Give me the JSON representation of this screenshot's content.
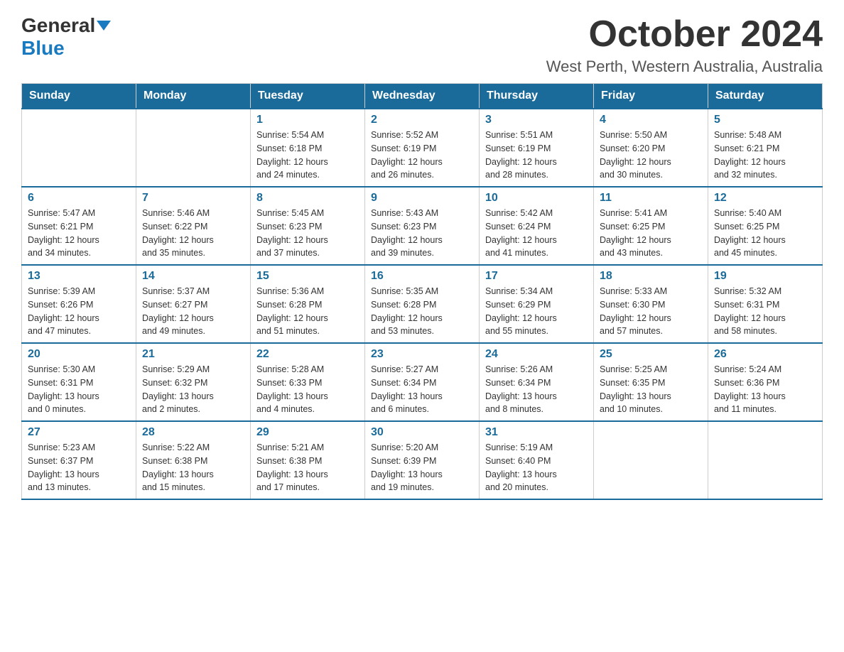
{
  "header": {
    "logo_general": "General",
    "logo_blue": "Blue",
    "month_title": "October 2024",
    "location": "West Perth, Western Australia, Australia"
  },
  "weekdays": [
    "Sunday",
    "Monday",
    "Tuesday",
    "Wednesday",
    "Thursday",
    "Friday",
    "Saturday"
  ],
  "weeks": [
    [
      {
        "day": "",
        "info": ""
      },
      {
        "day": "",
        "info": ""
      },
      {
        "day": "1",
        "info": "Sunrise: 5:54 AM\nSunset: 6:18 PM\nDaylight: 12 hours\nand 24 minutes."
      },
      {
        "day": "2",
        "info": "Sunrise: 5:52 AM\nSunset: 6:19 PM\nDaylight: 12 hours\nand 26 minutes."
      },
      {
        "day": "3",
        "info": "Sunrise: 5:51 AM\nSunset: 6:19 PM\nDaylight: 12 hours\nand 28 minutes."
      },
      {
        "day": "4",
        "info": "Sunrise: 5:50 AM\nSunset: 6:20 PM\nDaylight: 12 hours\nand 30 minutes."
      },
      {
        "day": "5",
        "info": "Sunrise: 5:48 AM\nSunset: 6:21 PM\nDaylight: 12 hours\nand 32 minutes."
      }
    ],
    [
      {
        "day": "6",
        "info": "Sunrise: 5:47 AM\nSunset: 6:21 PM\nDaylight: 12 hours\nand 34 minutes."
      },
      {
        "day": "7",
        "info": "Sunrise: 5:46 AM\nSunset: 6:22 PM\nDaylight: 12 hours\nand 35 minutes."
      },
      {
        "day": "8",
        "info": "Sunrise: 5:45 AM\nSunset: 6:23 PM\nDaylight: 12 hours\nand 37 minutes."
      },
      {
        "day": "9",
        "info": "Sunrise: 5:43 AM\nSunset: 6:23 PM\nDaylight: 12 hours\nand 39 minutes."
      },
      {
        "day": "10",
        "info": "Sunrise: 5:42 AM\nSunset: 6:24 PM\nDaylight: 12 hours\nand 41 minutes."
      },
      {
        "day": "11",
        "info": "Sunrise: 5:41 AM\nSunset: 6:25 PM\nDaylight: 12 hours\nand 43 minutes."
      },
      {
        "day": "12",
        "info": "Sunrise: 5:40 AM\nSunset: 6:25 PM\nDaylight: 12 hours\nand 45 minutes."
      }
    ],
    [
      {
        "day": "13",
        "info": "Sunrise: 5:39 AM\nSunset: 6:26 PM\nDaylight: 12 hours\nand 47 minutes."
      },
      {
        "day": "14",
        "info": "Sunrise: 5:37 AM\nSunset: 6:27 PM\nDaylight: 12 hours\nand 49 minutes."
      },
      {
        "day": "15",
        "info": "Sunrise: 5:36 AM\nSunset: 6:28 PM\nDaylight: 12 hours\nand 51 minutes."
      },
      {
        "day": "16",
        "info": "Sunrise: 5:35 AM\nSunset: 6:28 PM\nDaylight: 12 hours\nand 53 minutes."
      },
      {
        "day": "17",
        "info": "Sunrise: 5:34 AM\nSunset: 6:29 PM\nDaylight: 12 hours\nand 55 minutes."
      },
      {
        "day": "18",
        "info": "Sunrise: 5:33 AM\nSunset: 6:30 PM\nDaylight: 12 hours\nand 57 minutes."
      },
      {
        "day": "19",
        "info": "Sunrise: 5:32 AM\nSunset: 6:31 PM\nDaylight: 12 hours\nand 58 minutes."
      }
    ],
    [
      {
        "day": "20",
        "info": "Sunrise: 5:30 AM\nSunset: 6:31 PM\nDaylight: 13 hours\nand 0 minutes."
      },
      {
        "day": "21",
        "info": "Sunrise: 5:29 AM\nSunset: 6:32 PM\nDaylight: 13 hours\nand 2 minutes."
      },
      {
        "day": "22",
        "info": "Sunrise: 5:28 AM\nSunset: 6:33 PM\nDaylight: 13 hours\nand 4 minutes."
      },
      {
        "day": "23",
        "info": "Sunrise: 5:27 AM\nSunset: 6:34 PM\nDaylight: 13 hours\nand 6 minutes."
      },
      {
        "day": "24",
        "info": "Sunrise: 5:26 AM\nSunset: 6:34 PM\nDaylight: 13 hours\nand 8 minutes."
      },
      {
        "day": "25",
        "info": "Sunrise: 5:25 AM\nSunset: 6:35 PM\nDaylight: 13 hours\nand 10 minutes."
      },
      {
        "day": "26",
        "info": "Sunrise: 5:24 AM\nSunset: 6:36 PM\nDaylight: 13 hours\nand 11 minutes."
      }
    ],
    [
      {
        "day": "27",
        "info": "Sunrise: 5:23 AM\nSunset: 6:37 PM\nDaylight: 13 hours\nand 13 minutes."
      },
      {
        "day": "28",
        "info": "Sunrise: 5:22 AM\nSunset: 6:38 PM\nDaylight: 13 hours\nand 15 minutes."
      },
      {
        "day": "29",
        "info": "Sunrise: 5:21 AM\nSunset: 6:38 PM\nDaylight: 13 hours\nand 17 minutes."
      },
      {
        "day": "30",
        "info": "Sunrise: 5:20 AM\nSunset: 6:39 PM\nDaylight: 13 hours\nand 19 minutes."
      },
      {
        "day": "31",
        "info": "Sunrise: 5:19 AM\nSunset: 6:40 PM\nDaylight: 13 hours\nand 20 minutes."
      },
      {
        "day": "",
        "info": ""
      },
      {
        "day": "",
        "info": ""
      }
    ]
  ]
}
